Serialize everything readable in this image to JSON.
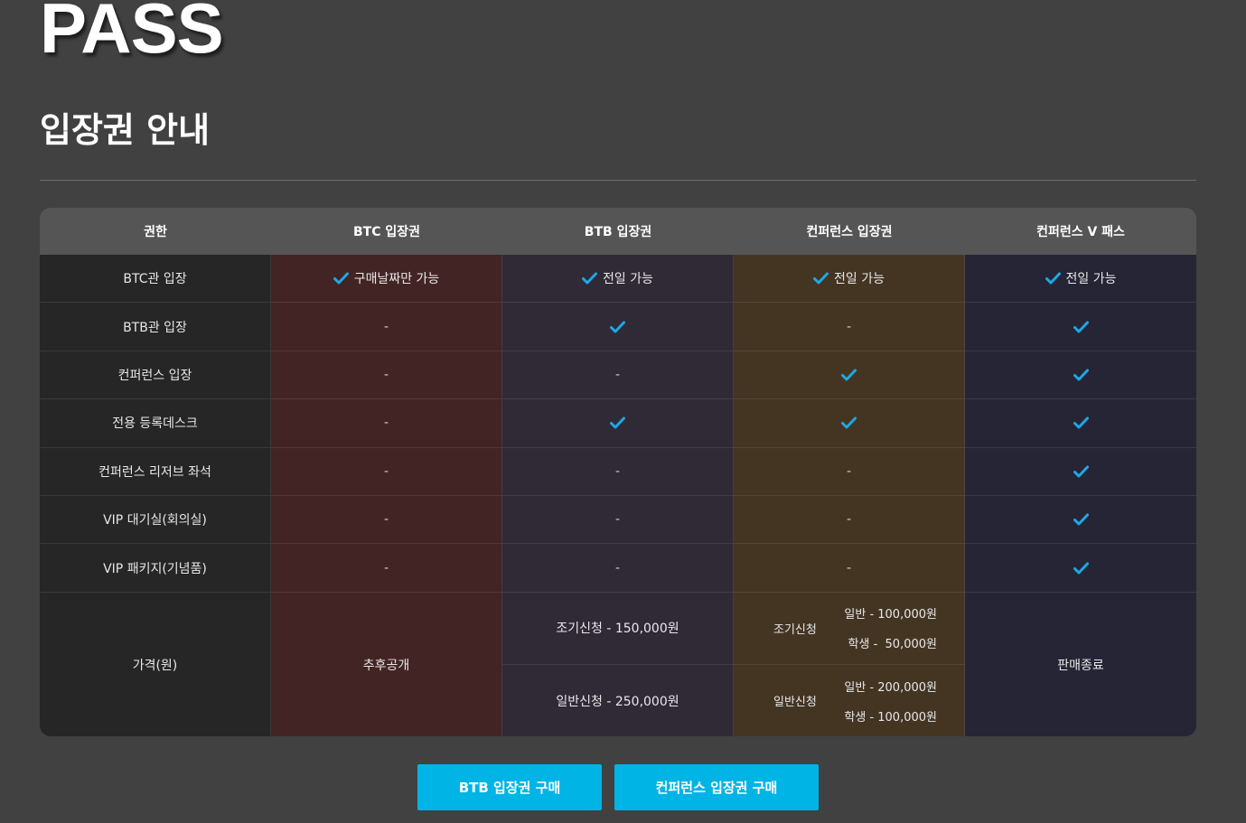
{
  "logo": "PASS",
  "page_title": "입장권 안내",
  "colors": {
    "check": "#1ba9e6",
    "button": "#00b4e6",
    "col_btc": "#432424",
    "col_btb": "#302a37",
    "col_conf": "#443523",
    "col_vpass": "#262536"
  },
  "table": {
    "headers": [
      "권한",
      "BTC 입장권",
      "BTB 입장권",
      "컨퍼런스 입장권",
      "컨퍼런스 V 패스"
    ],
    "rows": [
      {
        "label": "BTC관 입장",
        "cells": [
          {
            "check": true,
            "text": "구매날짜만 가능"
          },
          {
            "check": true,
            "text": "전일 가능"
          },
          {
            "check": true,
            "text": "전일 가능"
          },
          {
            "check": true,
            "text": "전일 가능"
          }
        ]
      },
      {
        "label": "BTB관 입장",
        "cells": [
          {
            "check": false,
            "text": "-"
          },
          {
            "check": true,
            "text": ""
          },
          {
            "check": false,
            "text": "-"
          },
          {
            "check": true,
            "text": ""
          }
        ]
      },
      {
        "label": "컨퍼런스 입장",
        "cells": [
          {
            "check": false,
            "text": "-"
          },
          {
            "check": false,
            "text": "-"
          },
          {
            "check": true,
            "text": ""
          },
          {
            "check": true,
            "text": ""
          }
        ]
      },
      {
        "label": "전용 등록데스크",
        "cells": [
          {
            "check": false,
            "text": "-"
          },
          {
            "check": true,
            "text": ""
          },
          {
            "check": true,
            "text": ""
          },
          {
            "check": true,
            "text": ""
          }
        ]
      },
      {
        "label": "컨퍼런스 리저브 좌석",
        "cells": [
          {
            "check": false,
            "text": "-"
          },
          {
            "check": false,
            "text": "-"
          },
          {
            "check": false,
            "text": "-"
          },
          {
            "check": true,
            "text": ""
          }
        ]
      },
      {
        "label": "VIP 대기실(회의실)",
        "cells": [
          {
            "check": false,
            "text": "-"
          },
          {
            "check": false,
            "text": "-"
          },
          {
            "check": false,
            "text": "-"
          },
          {
            "check": true,
            "text": ""
          }
        ]
      },
      {
        "label": "VIP 패키지(기념품)",
        "cells": [
          {
            "check": false,
            "text": "-"
          },
          {
            "check": false,
            "text": "-"
          },
          {
            "check": false,
            "text": "-"
          },
          {
            "check": true,
            "text": ""
          }
        ]
      }
    ],
    "price": {
      "label": "가격(원)",
      "btc": "추후공개",
      "btb_early": "조기신청 - 150,000원",
      "btb_regular": "일반신청 - 250,000원",
      "conf_early": {
        "label": "조기신청",
        "general": "일반 - 100,000원",
        "student": "학생 -  50,000원"
      },
      "conf_regular": {
        "label": "일반신청",
        "general": "일반 - 200,000원",
        "student": "학생 - 100,000원"
      },
      "vpass": "판매종료"
    }
  },
  "buttons": {
    "btb": "BTB 입장권 구매",
    "conference": "컨퍼런스 입장권 구매"
  }
}
